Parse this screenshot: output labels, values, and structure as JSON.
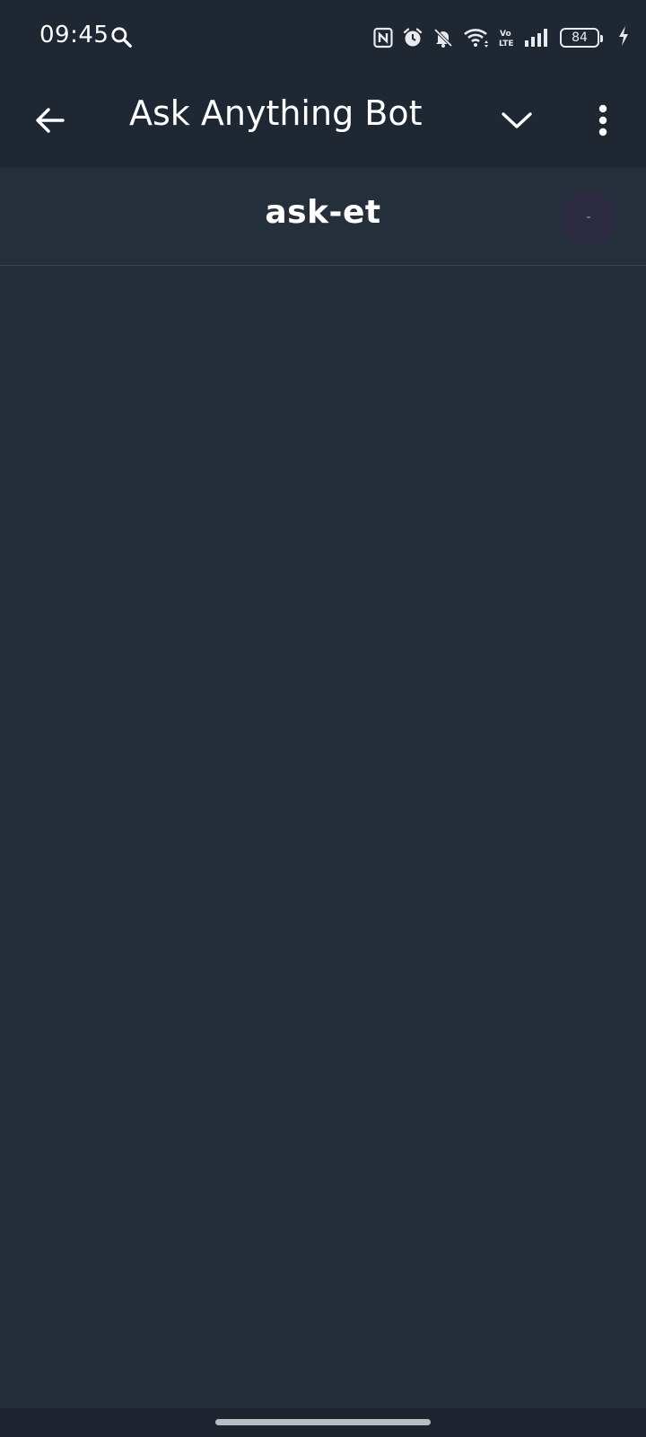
{
  "status_bar": {
    "time": "09:45",
    "battery_level": "84",
    "icons": [
      "search-icon",
      "nfc-icon",
      "alarm-icon",
      "bell-off-icon",
      "wifi-icon",
      "volte-icon",
      "signal-icon",
      "battery-icon",
      "charging-icon"
    ]
  },
  "app_bar": {
    "title": "Ask Anything Bot",
    "back_icon": "arrow-left-icon",
    "dropdown_icon": "chevron-down-icon",
    "menu_icon": "more-vert-icon"
  },
  "channel": {
    "name": "ask-et",
    "badge": "-"
  },
  "colors": {
    "background": "#242d3a",
    "bar_background": "#1f2733",
    "text": "#ffffff",
    "badge_background": "#2b2a40"
  }
}
